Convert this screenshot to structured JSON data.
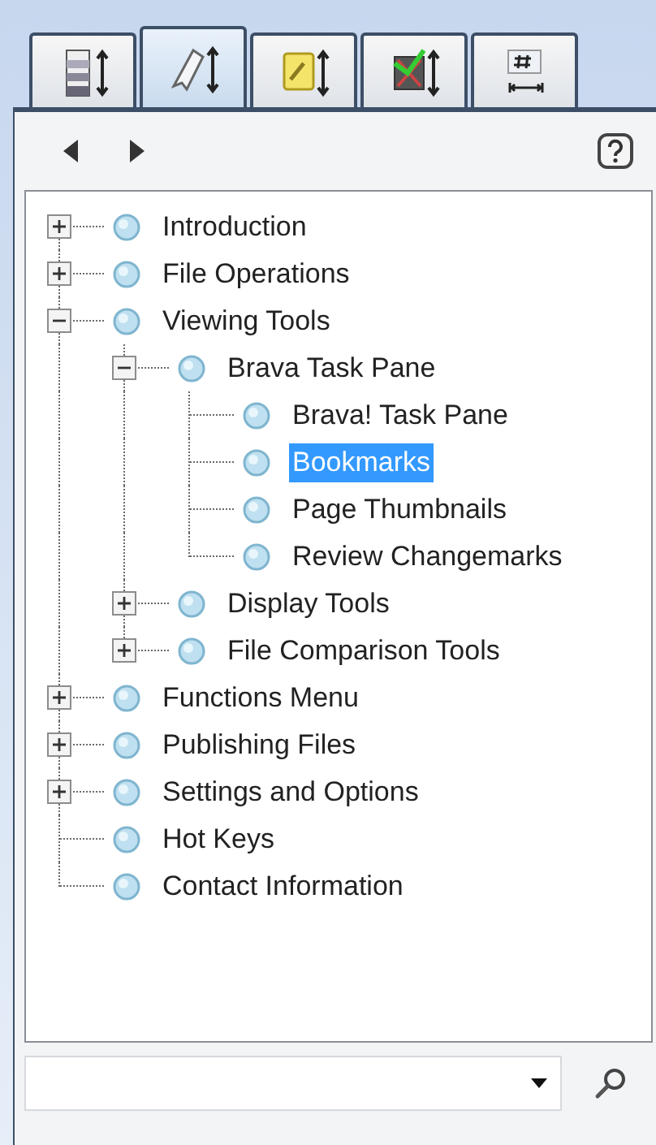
{
  "tabs": [
    {
      "kind": "layers",
      "selected": false
    },
    {
      "kind": "bookmark",
      "selected": true
    },
    {
      "kind": "note",
      "selected": false
    },
    {
      "kind": "markup",
      "selected": false
    },
    {
      "kind": "numbering",
      "selected": false
    }
  ],
  "tree": [
    {
      "label": "Introduction",
      "expanded": false,
      "selected": false
    },
    {
      "label": "File Operations",
      "expanded": false,
      "selected": false
    },
    {
      "label": "Viewing Tools",
      "expanded": true,
      "selected": false,
      "children": [
        {
          "label": "Brava Task Pane",
          "expanded": true,
          "selected": false,
          "children": [
            {
              "label": "Brava! Task Pane",
              "selected": false
            },
            {
              "label": "Bookmarks",
              "selected": true
            },
            {
              "label": "Page Thumbnails",
              "selected": false
            },
            {
              "label": "Review Changemarks",
              "selected": false
            }
          ]
        },
        {
          "label": "Display Tools",
          "expanded": false,
          "selected": false
        },
        {
          "label": "File Comparison Tools",
          "expanded": false,
          "selected": false
        }
      ]
    },
    {
      "label": "Functions Menu",
      "expanded": false,
      "selected": false
    },
    {
      "label": "Publishing Files",
      "expanded": false,
      "selected": false
    },
    {
      "label": "Settings and Options",
      "expanded": false,
      "selected": false
    },
    {
      "label": "Hot Keys",
      "selected": false
    },
    {
      "label": "Contact Information",
      "selected": false
    }
  ]
}
